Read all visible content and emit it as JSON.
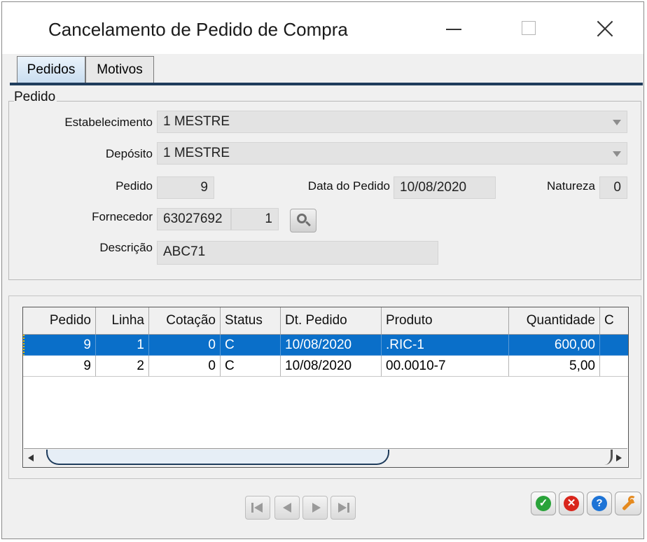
{
  "window": {
    "title": "Cancelamento de Pedido de Compra"
  },
  "tabs": [
    {
      "label": "Pedidos",
      "active": true
    },
    {
      "label": "Motivos",
      "active": false
    }
  ],
  "group": {
    "title": "Pedido",
    "estabelecimento": {
      "label": "Estabelecimento",
      "value": "1 MESTRE"
    },
    "deposito": {
      "label": "Depósito",
      "value": "1 MESTRE"
    },
    "pedido": {
      "label": "Pedido",
      "value": "9"
    },
    "data_pedido": {
      "label": "Data do Pedido",
      "value": "10/08/2020"
    },
    "natureza": {
      "label": "Natureza",
      "value": "0"
    },
    "fornecedor": {
      "label": "Fornecedor",
      "code": "63027692",
      "branch": "1"
    },
    "descricao": {
      "label": "Descrição",
      "value": "ABC71"
    }
  },
  "grid": {
    "columns": [
      "Pedido",
      "Linha",
      "Cotação",
      "Status",
      "Dt. Pedido",
      "Produto",
      "Quantidade",
      "C"
    ],
    "rows": [
      {
        "pedido": "9",
        "linha": "1",
        "cotacao": "0",
        "status": "C",
        "dt_pedido": "10/08/2020",
        "produto": ".RIC-1",
        "quantidade": "600,00",
        "selected": true
      },
      {
        "pedido": "9",
        "linha": "2",
        "cotacao": "0",
        "status": "C",
        "dt_pedido": "10/08/2020",
        "produto": "00.0010-7",
        "quantidade": "5,00",
        "selected": false
      }
    ]
  },
  "icons": {
    "nav": [
      "first-icon",
      "prev-icon",
      "next-icon",
      "last-icon"
    ],
    "actions": [
      "confirm-icon",
      "cancel-icon",
      "help-icon",
      "wrench-icon"
    ]
  },
  "colors": {
    "selection": "#0a6fc9",
    "confirm": "#2aa33a",
    "cancel": "#d9261c",
    "help": "#1e74d6",
    "wrench": "#e58a1f"
  }
}
